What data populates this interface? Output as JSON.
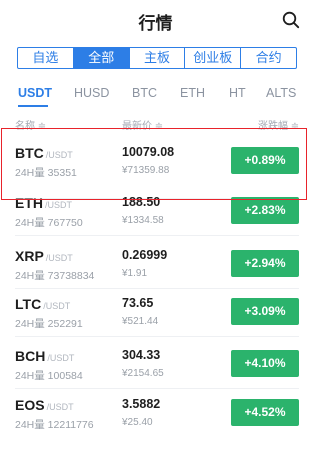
{
  "header": {
    "title": "行情"
  },
  "segments": [
    {
      "label": "自选",
      "selected": false
    },
    {
      "label": "全部",
      "selected": true
    },
    {
      "label": "主板",
      "selected": false
    },
    {
      "label": "创业板",
      "selected": false
    },
    {
      "label": "合约",
      "selected": false
    }
  ],
  "quote_tabs": [
    {
      "label": "USDT",
      "active": true
    },
    {
      "label": "HUSD",
      "active": false
    },
    {
      "label": "BTC",
      "active": false
    },
    {
      "label": "ETH",
      "active": false
    },
    {
      "label": "HT",
      "active": false
    },
    {
      "label": "ALTS",
      "active": false
    }
  ],
  "columns": {
    "name": "名称 ≑",
    "price": "最新价 ≑",
    "change": "涨跌幅 ≑"
  },
  "rows": [
    {
      "symbol": "BTC",
      "quote": "/USDT",
      "volume": "24H量 35351",
      "price": "10079.08",
      "cny": "¥71359.88",
      "change": "+0.89%"
    },
    {
      "symbol": "ETH",
      "quote": "/USDT",
      "volume": "24H量 767750",
      "price": "188.50",
      "cny": "¥1334.58",
      "change": "+2.83%"
    },
    {
      "symbol": "XRP",
      "quote": "/USDT",
      "volume": "24H量 73738834",
      "price": "0.26999",
      "cny": "¥1.91",
      "change": "+2.94%"
    },
    {
      "symbol": "LTC",
      "quote": "/USDT",
      "volume": "24H量 252291",
      "price": "73.65",
      "cny": "¥521.44",
      "change": "+3.09%"
    },
    {
      "symbol": "BCH",
      "quote": "/USDT",
      "volume": "24H量 100584",
      "price": "304.33",
      "cny": "¥2154.65",
      "change": "+4.10%"
    },
    {
      "symbol": "EOS",
      "quote": "/USDT",
      "volume": "24H量 12211776",
      "price": "3.5882",
      "cny": "¥25.40",
      "change": "+4.52%"
    }
  ],
  "colors": {
    "accent": "#2d7ee6",
    "up": "#2bb36c",
    "highlight": "#e8232b"
  }
}
